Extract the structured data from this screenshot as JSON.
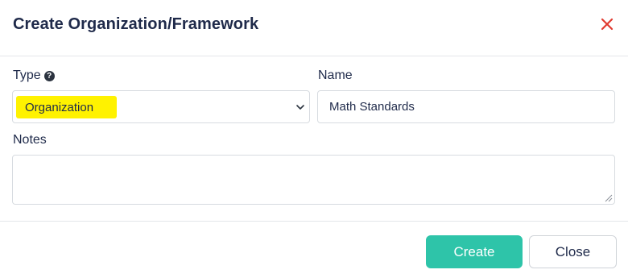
{
  "dialog": {
    "title": "Create Organization/Framework",
    "close_icon": "close-icon",
    "close_icon_color": "#e03a2f"
  },
  "form": {
    "type": {
      "label": "Type",
      "help_icon": "question-circle-icon",
      "help_glyph": "?",
      "selected_value": "Organization",
      "highlight_color": "#fff200"
    },
    "name": {
      "label": "Name",
      "value": "Math Standards"
    },
    "notes": {
      "label": "Notes",
      "value": ""
    }
  },
  "footer": {
    "create_label": "Create",
    "close_label": "Close",
    "create_color": "#2ec4a9"
  }
}
